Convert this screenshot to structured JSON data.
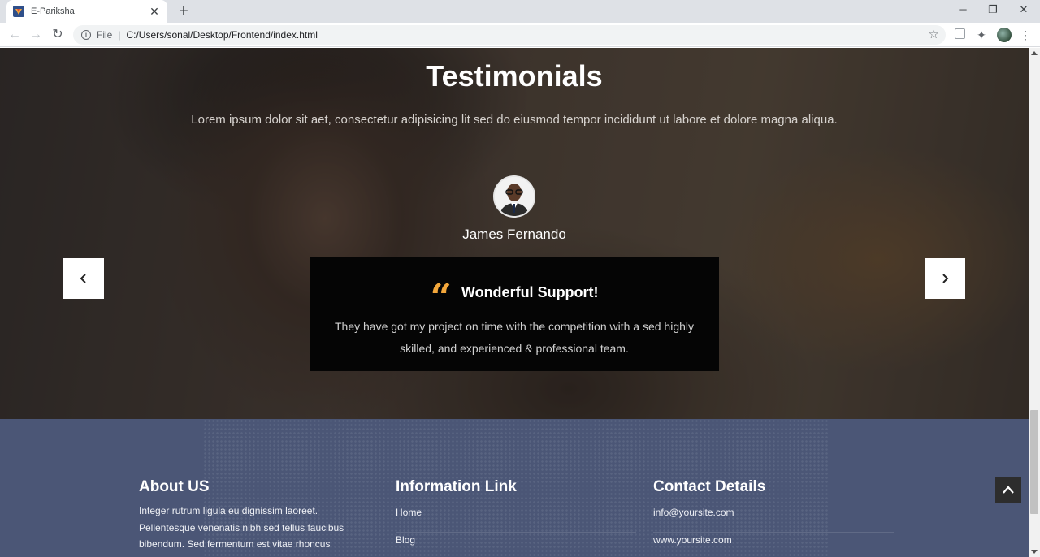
{
  "browser": {
    "tab_title": "E-Pariksha",
    "new_tab": "+",
    "scheme": "File",
    "separator": "|",
    "url": "C:/Users/sonal/Desktop/Frontend/index.html",
    "minimize": "─",
    "restore": "❐",
    "close": "✕"
  },
  "testimonials": {
    "title": "Testimonials",
    "subtitle": "Lorem ipsum dolor sit aet, consectetur adipisicing lit sed do eiusmod tempor incididunt ut labore et dolore magna aliqua.",
    "person_name": "James Fernando",
    "quote_title": "Wonderful Support!",
    "quote_text": "They have got my project on time with the competition with a sed highly skilled, and experienced & professional team.",
    "accent_color": "#f3a73b"
  },
  "footer": {
    "about": {
      "title": "About US",
      "text": "Integer rutrum ligula eu dignissim laoreet. Pellentesque venenatis nibh sed tellus faucibus bibendum. Sed fermentum est vitae rhoncus"
    },
    "info": {
      "title": "Information Link",
      "links": [
        "Home",
        "Blog"
      ]
    },
    "contact": {
      "title": "Contact Details",
      "items": [
        "info@yoursite.com",
        "www.yoursite.com"
      ]
    },
    "background_color": "#4b5676"
  }
}
